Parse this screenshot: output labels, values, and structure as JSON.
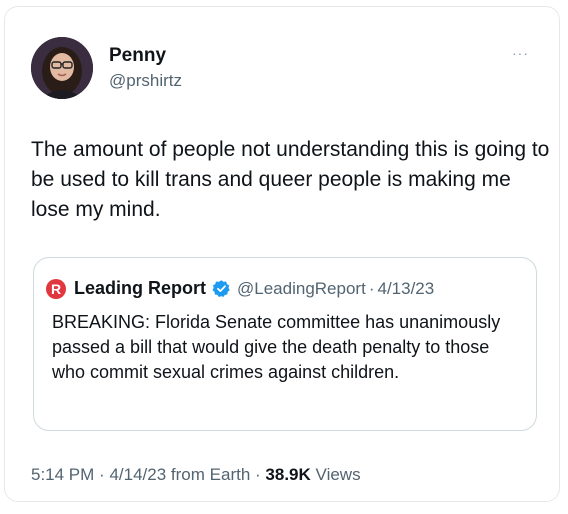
{
  "author": {
    "name": "Penny",
    "handle": "@prshirtz"
  },
  "tweet": {
    "text": "The amount of people not understanding this is going to be used to kill trans and queer people is making me lose my mind.",
    "time": "5:14 PM",
    "date": "4/14/23",
    "source": "from Earth",
    "views_count": "38.9K",
    "views_label": "Views"
  },
  "quote": {
    "logo_letter": "R",
    "name": "Leading Report",
    "handle": "@LeadingReport",
    "date": "4/13/23",
    "text": "BREAKING: Florida Senate committee has unanimously passed a bill that would give the death penalty to those who commit sexual crimes against children."
  },
  "more_label": "···",
  "separator": "·",
  "colors": {
    "verified": "#1d9bf0",
    "logo": "#e0383e",
    "secondary_text": "#536471"
  }
}
